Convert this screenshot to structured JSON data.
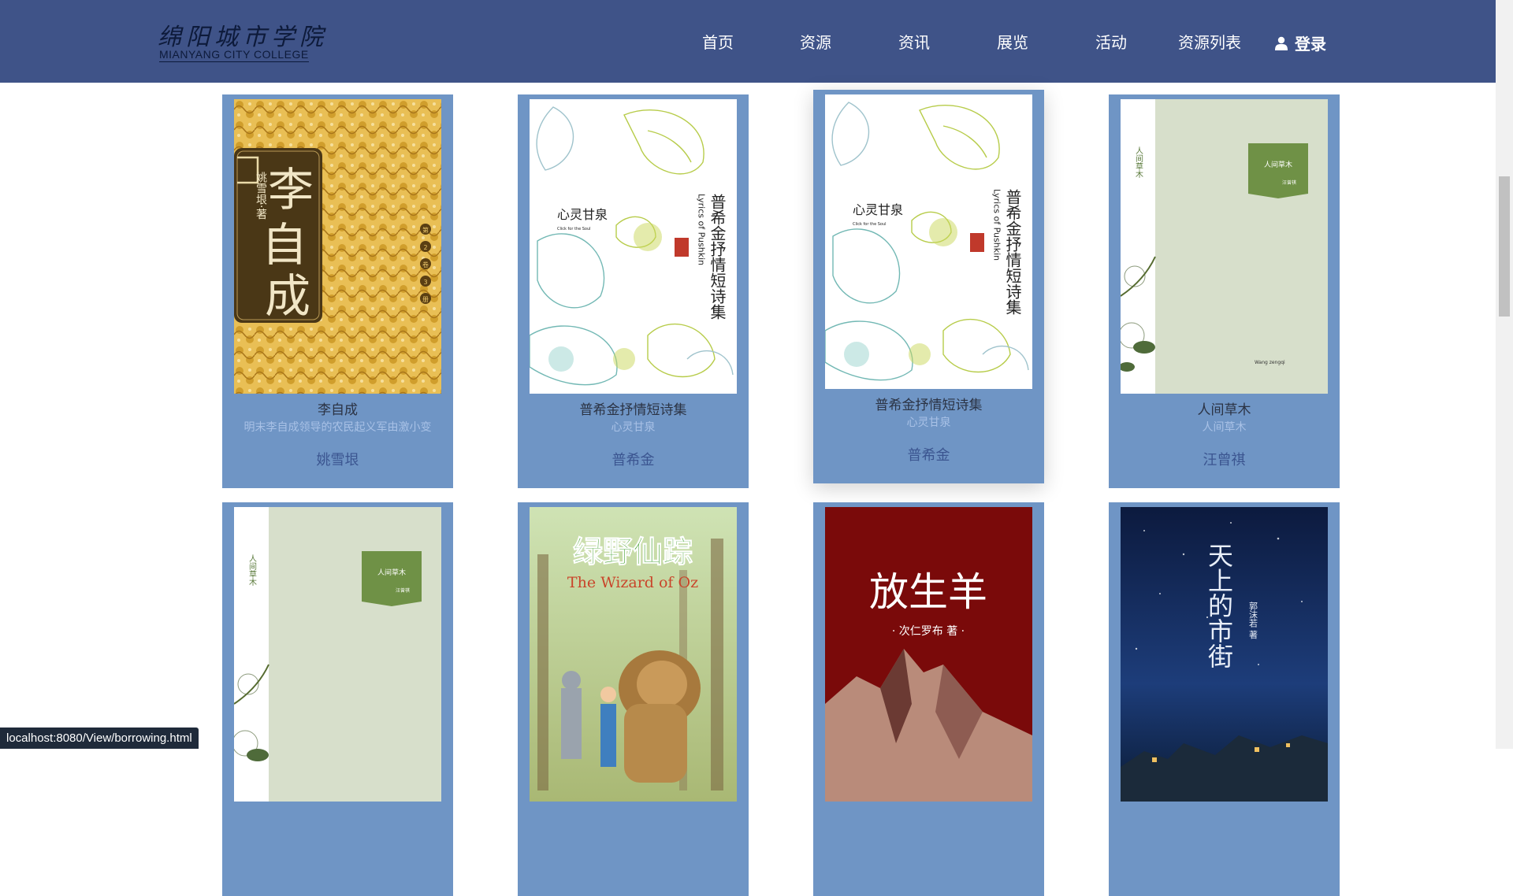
{
  "header": {
    "logo_cn": "绵阳城市学院",
    "logo_en": "MIANYANG CITY COLLEGE",
    "nav": [
      "首页",
      "资源",
      "资讯",
      "展览",
      "活动",
      "资源列表"
    ],
    "login_label": "登录"
  },
  "books": [
    {
      "title": "李自成",
      "subtitle": "明末李自成领导的农民起义军由激小变",
      "author": "姚雪垠",
      "cover": {
        "title": "李自成",
        "author_line": "姚雪垠·著",
        "vol": [
          "第",
          "2",
          "卷",
          "3",
          "册"
        ]
      }
    },
    {
      "title": "普希金抒情短诗集",
      "subtitle": "心灵甘泉",
      "author": "普希金",
      "cover": {
        "series": "心灵甘泉",
        "series_en": "Click for the Soul",
        "title": "普希金抒情短诗集",
        "title_en": "Lyrics of Pushkin"
      }
    },
    {
      "title": "普希金抒情短诗集",
      "subtitle": "心灵甘泉",
      "author": "普希金",
      "cover": {
        "series": "心灵甘泉",
        "series_en": "Click for the Soul",
        "title": "普希金抒情短诗集",
        "title_en": "Lyrics of Pushkin"
      }
    },
    {
      "title": "人间草木",
      "subtitle": "人间草木",
      "author": "汪曾祺",
      "cover": {
        "spine": "人间草木",
        "title": "人间草木",
        "author": "汪曾祺",
        "en": "Wang zengqi"
      }
    },
    {
      "cover": {
        "spine": "人间草木",
        "title": "人间草木",
        "author": "汪曾祺"
      }
    },
    {
      "cover": {
        "title": "绿野仙踪",
        "title_en": "The Wizard of Oz"
      }
    },
    {
      "cover": {
        "title": "放生羊",
        "author_line": "· 次仁罗布 著 ·"
      }
    },
    {
      "cover": {
        "title": "天上的市街",
        "author_line": "郭沫若 著"
      }
    }
  ],
  "status_url": "localhost:8080/View/borrowing.html",
  "colors": {
    "header": "#3f5388",
    "card": "#6f95c5",
    "title_text": "#2b3344",
    "author_text": "#3b5590"
  }
}
